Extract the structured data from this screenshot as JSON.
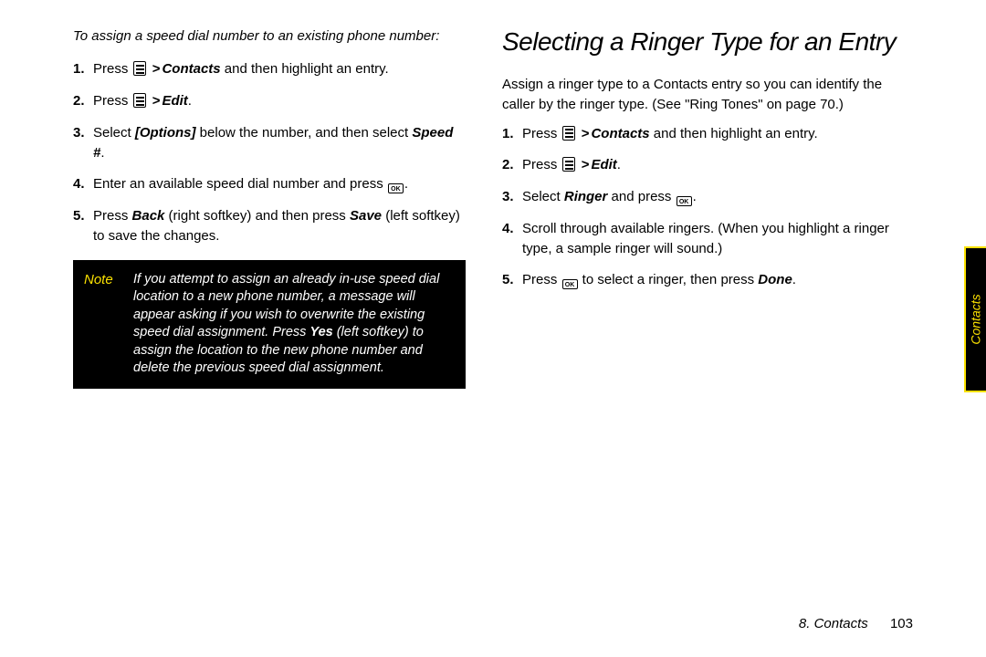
{
  "left": {
    "intro": "To assign a speed dial number to an existing phone number:",
    "steps": {
      "contacts_label": "Contacts",
      "highlight_entry": " and then highlight an entry.",
      "press": "Press ",
      "edit_label": "Edit",
      "step3_a": "Select ",
      "step3_options": "[Options]",
      "step3_b": " below the number, and then select ",
      "step3_speed": "Speed #",
      "step4": "Enter an available speed dial number and press ",
      "step5_a": "Press ",
      "step5_back": "Back",
      "step5_b": " (right softkey) and then press ",
      "step5_save": "Save",
      "step5_c": " (left softkey) to save the changes."
    },
    "note_label": "Note",
    "note_text_a": "If you attempt to assign an already in-use speed dial location to a new phone number, a message will appear asking if you wish to overwrite the existing speed dial assignment. Press ",
    "note_text_yes": "Yes",
    "note_text_b": " (left softkey) to assign the location to the new phone number and delete the previous speed dial assignment."
  },
  "right": {
    "heading": "Selecting a Ringer Type for an Entry",
    "body": "Assign a ringer type to a Contacts entry so you can identify the caller by the ringer type. (See \"Ring Tones\" on page 70.)",
    "steps": {
      "press": "Press ",
      "contacts_label": "Contacts",
      "highlight_entry": " and then highlight an entry.",
      "edit_label": "Edit",
      "step3_a": "Select ",
      "step3_ringer": "Ringer",
      "step3_b": " and press ",
      "step4": "Scroll through available ringers. (When you highlight a ringer type, a sample ringer will sound.)",
      "step5_a": "Press ",
      "step5_b": " to select a ringer, then press ",
      "step5_done": "Done"
    }
  },
  "side_tab": "Contacts",
  "footer": {
    "chapter": "8. Contacts",
    "page": "103"
  }
}
